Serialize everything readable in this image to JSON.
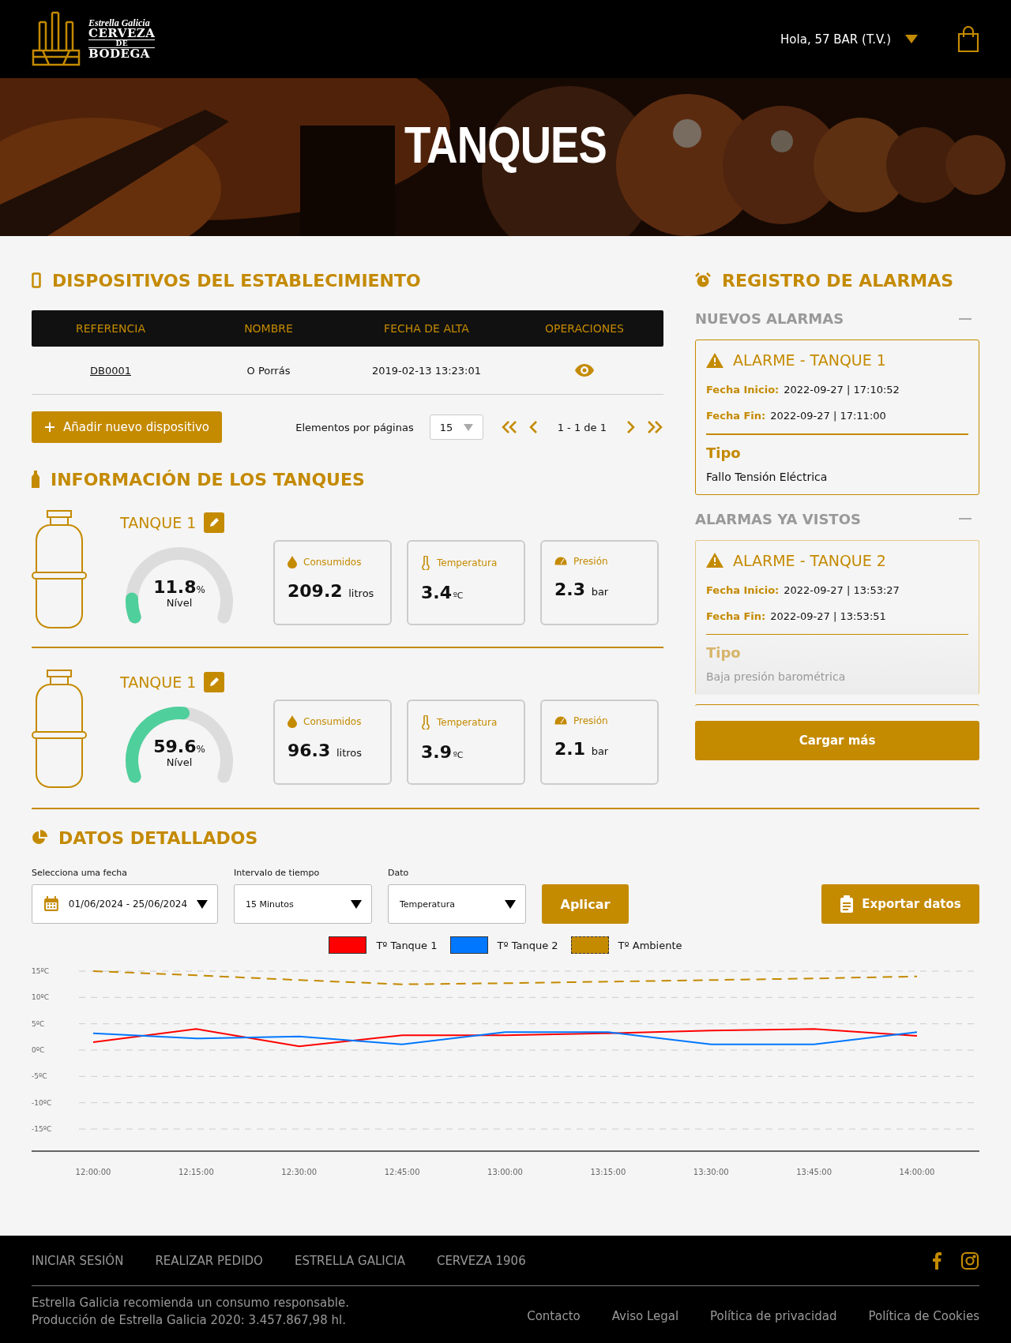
{
  "header": {
    "logo": {
      "brand": "Estrella Galicia",
      "line_1": "CERVEZA",
      "line_2": "DE",
      "line_3": "BODEGA"
    },
    "greeting": "Hola, 57 BAR (T.V.)"
  },
  "hero": {
    "title": "TANQUES"
  },
  "devices": {
    "title": "DISPOSITIVOS DEL ESTABLECIMIENTO",
    "table": {
      "columns": [
        "REFERENCIA",
        "NOMBRE",
        "FECHA DE ALTA",
        "OPERACIONES"
      ],
      "rows": [
        {
          "reference": "DB0001",
          "name": "O Porrás",
          "date": "2019-02-13 13:23:01"
        }
      ]
    },
    "add_button": "Añadir nuevo dispositivo",
    "pagination": {
      "per_page_label": "Elementos por páginas",
      "per_page": "15",
      "range": "1 - 1 de 1"
    }
  },
  "tanks": {
    "title": "INFORMACIÓN DE LOS TANQUES",
    "items": [
      {
        "name": "TANQUE 1",
        "level": 0.118,
        "level_value": "11.8",
        "level_unit": "%",
        "level_label": "Nível",
        "metrics": [
          {
            "kind": "consumed",
            "label": "Consumidos",
            "value": "209.2",
            "unit": "litros"
          },
          {
            "kind": "temperature",
            "label": "Temperatura",
            "value": "3.4",
            "unit": "ºC"
          },
          {
            "kind": "pressure",
            "label": "Presión",
            "value": "2.3",
            "unit": "bar"
          }
        ]
      },
      {
        "name": "TANQUE 1",
        "level": 0.596,
        "level_value": "59.6",
        "level_unit": "%",
        "level_label": "Nível",
        "metrics": [
          {
            "kind": "consumed",
            "label": "Consumidos",
            "value": "96.3",
            "unit": "litros"
          },
          {
            "kind": "temperature",
            "label": "Temperatura",
            "value": "3.9",
            "unit": "ºC"
          },
          {
            "kind": "pressure",
            "label": "Presión",
            "value": "2.1",
            "unit": "bar"
          }
        ]
      }
    ]
  },
  "alarms": {
    "title": "REGISTRO DE ALARMAS",
    "groups": [
      {
        "title": "NUEVOS ALARMAS",
        "expanded": true,
        "items": [
          {
            "title": "ALARME - TANQUE 1",
            "start_label": "Fecha Inicio:",
            "start": "2022-09-27 | 17:10:52",
            "end_label": "Fecha Fin:",
            "end": "2022-09-27 |  17:11:00",
            "type_label": "Tipo",
            "type": "Fallo Tensión Eléctrica",
            "faded": false
          }
        ]
      },
      {
        "title": "ALARMAS YA VISTOS",
        "expanded": true,
        "items": [
          {
            "title": "ALARME - TANQUE 2",
            "start_label": "Fecha Inicio:",
            "start": "2022-09-27 | 13:53:27",
            "end_label": "Fecha Fin:",
            "end": "2022-09-27 |  13:53:51",
            "type_label": "Tipo",
            "type": "Baja presión barométrica",
            "faded": true
          }
        ]
      }
    ],
    "load_more": "Cargar más"
  },
  "details": {
    "title": "DATOS DETALLADOS",
    "filters": [
      {
        "kind": "date",
        "label": "Selecciona uma fecha",
        "value": "01/06/2024 - 25/06/2024"
      },
      {
        "kind": "select",
        "label": "Intervalo de tiempo",
        "value": "15 Minutos"
      },
      {
        "kind": "select",
        "label": "Dato",
        "value": "Temperatura"
      }
    ],
    "apply_button": "Aplicar",
    "export_button": "Exportar datos",
    "chart_data": {
      "type": "line",
      "categories": [
        "12:00:00",
        "12:15:00",
        "12:30:00",
        "12:45:00",
        "13:00:00",
        "13:15:00",
        "13:30:00",
        "13:45:00",
        "14:00:00"
      ],
      "series": [
        {
          "name": "Tº Tanque 1",
          "color": "#ff0000",
          "line_style": "solid",
          "values": [
            1.5,
            4,
            0.7,
            2.8,
            2.8,
            3.2,
            3.7,
            4,
            2.7
          ]
        },
        {
          "name": "Tº Tanque 2",
          "color": "#0077ff",
          "line_style": "solid",
          "values": [
            3.2,
            2.2,
            2.6,
            1.1,
            3.4,
            3.4,
            1.1,
            1.1,
            3.4
          ]
        },
        {
          "name": "Tº Ambiente",
          "color": "#c48a00",
          "line_style": "dashed",
          "values": [
            15,
            14.2,
            13.3,
            12.5,
            12.7,
            13,
            13.3,
            13.6,
            14
          ]
        }
      ],
      "ylim": [
        -15,
        15
      ],
      "grid": true,
      "yticks": [
        {
          "value": 15,
          "label": "15ºC"
        },
        {
          "value": 10,
          "label": "10ºC"
        },
        {
          "value": 5,
          "label": "5ºC"
        },
        {
          "value": 0,
          "label": "0ºC"
        },
        {
          "value": -5,
          "label": "-5ºC"
        },
        {
          "value": -10,
          "label": "-10ºC"
        },
        {
          "value": -15,
          "label": "-15ºC"
        }
      ]
    }
  },
  "footer": {
    "nav": [
      "INICIAR SESIÓN",
      "REALIZAR PEDIDO",
      "ESTRELLA GALICIA",
      "CERVEZA 1906"
    ],
    "notice": [
      "Estrella Galicia recomienda un consumo responsable.",
      "Producción de Estrella Galicia 2020: 3.457.867,98 hl."
    ],
    "legal": [
      "Contacto",
      "Aviso Legal",
      "Política de privacidad",
      "Política de Cookies"
    ]
  }
}
